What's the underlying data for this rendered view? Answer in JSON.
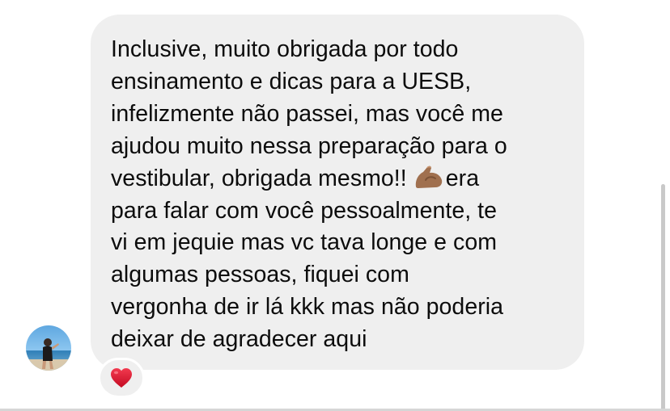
{
  "message": {
    "sender_avatar": "avatar",
    "lines": [
      "Inclusive, muito obrigada por todo",
      "ensinamento e dicas para a UESB,",
      "infelizmente não passei, mas você me",
      "ajudou muito nessa preparação para o",
      "vestibular, obrigada mesmo!!",
      "era",
      "para falar com você pessoalmente, te",
      "vi em jequie mas vc tava longe e com",
      "algumas pessoas, fiquei com",
      "vergonha de ir lá kkk mas não poderia",
      "deixar de agradecer aqui"
    ],
    "inline_emoji": "flexed-biceps-icon",
    "reaction": "red-heart-icon"
  },
  "colors": {
    "bubble": "#efefef",
    "text": "#0c0c0c",
    "reaction_heart": "#e0102e",
    "background": "#ffffff"
  }
}
